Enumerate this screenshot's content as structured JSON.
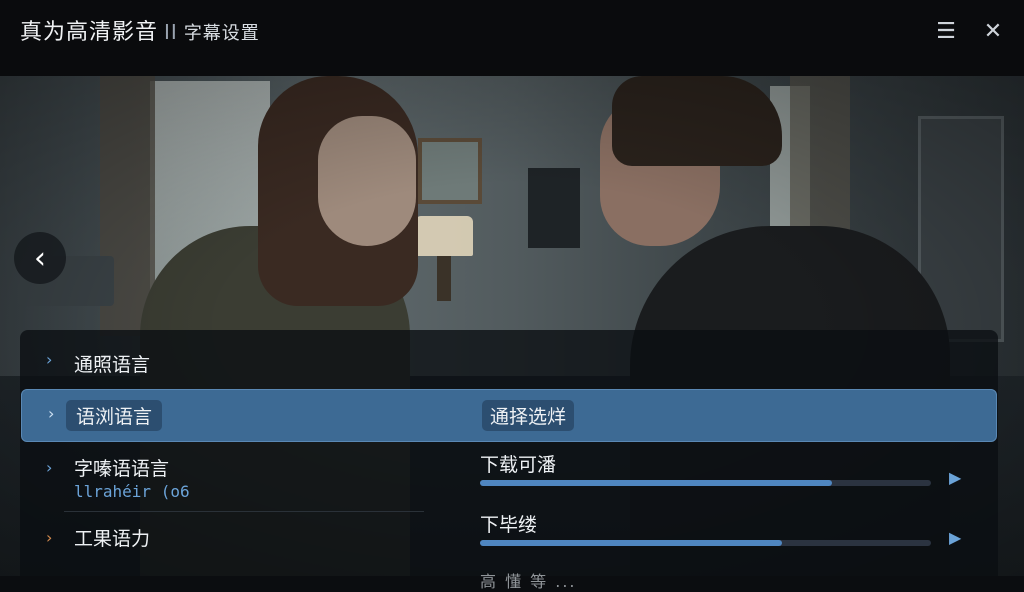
{
  "app": {
    "title": "真为高清影音",
    "separator": "II",
    "subtitle": "字幕设置"
  },
  "window_controls": {
    "menu_icon": "menu-icon",
    "close_icon": "close-icon"
  },
  "navigation": {
    "back_icon": "chevron-left-icon"
  },
  "settings": {
    "rows": [
      {
        "label": "通照语言"
      },
      {
        "label": "语浏语言",
        "value": "通择选烊"
      },
      {
        "label": "字嗪语语言",
        "subvalue": "llrahéir (o6"
      },
      {
        "label": "工果语力"
      }
    ],
    "sliders": [
      {
        "label": "下载可潘",
        "level": 0.78
      },
      {
        "label": "下毕缕",
        "level": 0.67
      }
    ],
    "partial_text": "高 懂 等 ..."
  },
  "colors": {
    "accent": "#3d6a94",
    "slider_fill": "#4f86c0",
    "chevron_blue": "#6ba3d8",
    "chevron_orange": "#d38a4e"
  }
}
